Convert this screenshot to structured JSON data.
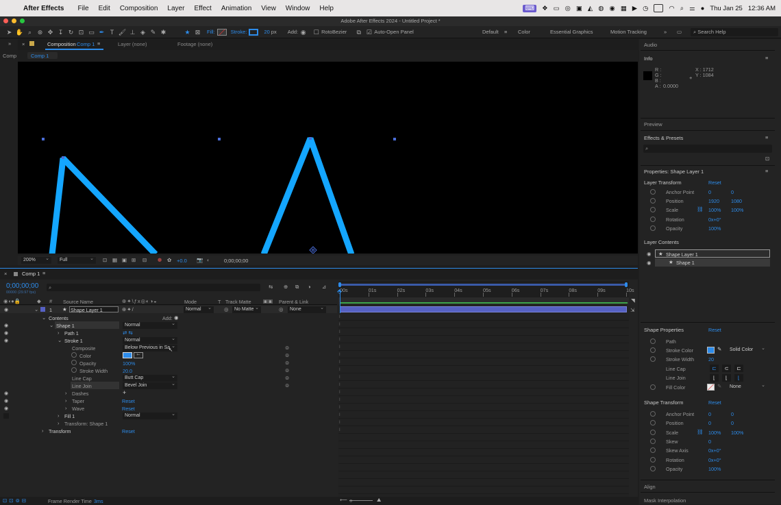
{
  "menubar": {
    "app": "After Effects",
    "items": [
      "File",
      "Edit",
      "Composition",
      "Layer",
      "Effect",
      "Animation",
      "View",
      "Window",
      "Help"
    ],
    "date": "Thu Jan 25",
    "time": "12:36 AM"
  },
  "window": {
    "title": "Adobe After Effects 2024 - Untitled Project *"
  },
  "toolbar": {
    "fill": "Fill:",
    "stroke": "Stroke:",
    "stroke_width": "20",
    "stroke_unit": "px",
    "add": "Add:",
    "rotobezier": "RotoBezier",
    "auto_open": "Auto-Open Panel",
    "workspaces": [
      "Default",
      "Color",
      "Essential Graphics",
      "Motion Tracking"
    ],
    "search": "Search Help"
  },
  "comp_panel": {
    "side_label": "Comp",
    "tab": "Composition",
    "tab_comp": "Comp 1",
    "layer_tab": "Layer (none)",
    "footage_tab": "Footage (none)",
    "breadcrumb": "Comp 1",
    "zoom": "200%",
    "res": "Full",
    "exposure": "+0.0",
    "timecode": "0;00;00;00"
  },
  "timeline": {
    "tab": "Comp 1",
    "timecode": "0;00;00;00",
    "fps": "00000 (29.97 fps)",
    "headers": {
      "source": "Source Name",
      "mode": "Mode",
      "t": "T",
      "matte": "Track Matte",
      "parent": "Parent & Link"
    },
    "ruler": [
      "00s",
      "01s",
      "02s",
      "03s",
      "04s",
      "05s",
      "06s",
      "07s",
      "08s",
      "09s",
      "10s"
    ],
    "layer": {
      "num": "1",
      "name": "Shape Layer 1",
      "mode": "Normal",
      "matte": "No Matte",
      "parent": "None"
    },
    "props": {
      "contents": "Contents",
      "add": "Add:",
      "shape1": "Shape 1",
      "shape1_mode": "Normal",
      "path1": "Path 1",
      "stroke1": "Stroke 1",
      "stroke1_mode": "Normal",
      "composite": "Composite",
      "composite_val": "Below Previous in Sa",
      "color": "Color",
      "opacity": "Opacity",
      "opacity_val": "100%",
      "stroke_width": "Stroke Width",
      "stroke_width_val": "20.0",
      "line_cap": "Line Cap",
      "line_cap_val": "Butt Cap",
      "line_join": "Line Join",
      "line_join_val": "Bevel Join",
      "dashes": "Dashes",
      "dashes_val": "+",
      "taper": "Taper",
      "taper_val": "Reset",
      "wave": "Wave",
      "wave_val": "Reset",
      "fill1": "Fill 1",
      "fill1_mode": "Normal",
      "transform_shape": "Transform: Shape 1",
      "transform": "Transform",
      "transform_val": "Reset"
    },
    "status": {
      "label": "Frame Render Time",
      "value": "3ms"
    }
  },
  "right": {
    "audio": "Audio",
    "info": "Info",
    "info_rgb": [
      "R :",
      "G :",
      "B :",
      "A :"
    ],
    "info_a": "0.0000",
    "info_x": "X : 1712",
    "info_y": "Y : 1084",
    "preview": "Preview",
    "effects": "Effects & Presets",
    "props_title": "Properties: Shape Layer 1",
    "layer_transform": "Layer Transform",
    "reset": "Reset",
    "lt_rows": [
      {
        "label": "Anchor Point",
        "v1": "0",
        "v2": "0"
      },
      {
        "label": "Position",
        "v1": "1920",
        "v2": "1080"
      },
      {
        "label": "Scale",
        "v1": "100%",
        "v2": "100%"
      },
      {
        "label": "Rotation",
        "v1": "0x+0°",
        "v2": ""
      },
      {
        "label": "Opacity",
        "v1": "100%",
        "v2": ""
      }
    ],
    "layer_contents": "Layer Contents",
    "lc_items": [
      "Shape Layer 1",
      "Shape 1"
    ],
    "shape_props": "Shape Properties",
    "sp": {
      "path": "Path",
      "stroke_color": "Stroke Color",
      "solid": "Solid Color",
      "stroke_width": "Stroke Width",
      "stroke_width_val": "20",
      "line_cap": "Line Cap",
      "line_join": "Line Join",
      "fill_color": "Fill Color",
      "fill_none": "None"
    },
    "shape_transform": "Shape Transform",
    "st_rows": [
      {
        "label": "Anchor Point",
        "v1": "0",
        "v2": "0"
      },
      {
        "label": "Position",
        "v1": "0",
        "v2": "0"
      },
      {
        "label": "Scale",
        "v1": "100%",
        "v2": "100%"
      },
      {
        "label": "Skew",
        "v1": "0",
        "v2": ""
      },
      {
        "label": "Skew Axis",
        "v1": "0x+0°",
        "v2": ""
      },
      {
        "label": "Rotation",
        "v1": "0x+0°",
        "v2": ""
      },
      {
        "label": "Opacity",
        "v1": "100%",
        "v2": ""
      }
    ],
    "align": "Align",
    "mask_interp": "Mask Interpolation"
  },
  "colors": {
    "accent": "#2d8ceb",
    "shape_stroke": "#14a6ff",
    "layer_bar": "#5661c4"
  }
}
